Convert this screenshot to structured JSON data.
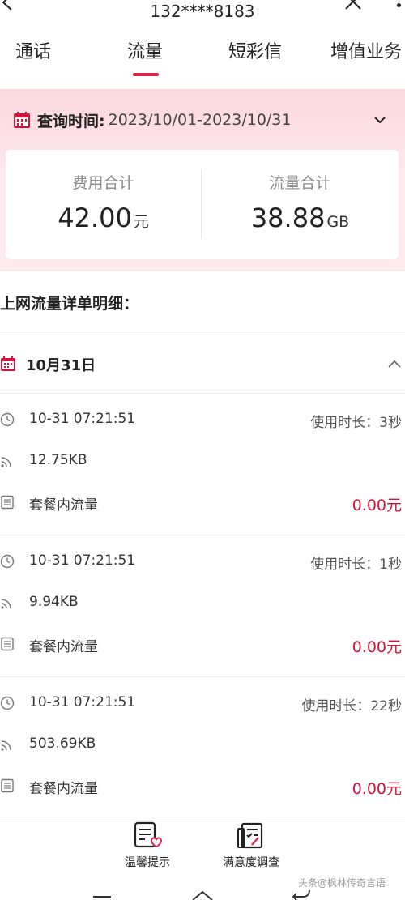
{
  "header": {
    "title": "132****8183"
  },
  "tabs": [
    {
      "label": "通话"
    },
    {
      "label": "流量"
    },
    {
      "label": "短彩信"
    },
    {
      "label": "增值业务"
    }
  ],
  "query": {
    "label": "查询时间:",
    "value": "2023/10/01-2023/10/31"
  },
  "summary": {
    "fee": {
      "label": "费用合计",
      "value": "42.00",
      "unit": "元"
    },
    "traffic": {
      "label": "流量合计",
      "value": "38.88",
      "unit": "GB"
    }
  },
  "section_title": "上网流量详单明细：",
  "day": {
    "label": "10月31日"
  },
  "records": [
    {
      "time": "10-31 07:21:51",
      "duration": "使用时长：3秒",
      "size": "12.75KB",
      "type": "套餐内流量",
      "amount": "0.00元"
    },
    {
      "time": "10-31 07:21:51",
      "duration": "使用时长：1秒",
      "size": "9.94KB",
      "type": "套餐内流量",
      "amount": "0.00元"
    },
    {
      "time": "10-31 07:21:51",
      "duration": "使用时长：22秒",
      "size": "503.69KB",
      "type": "套餐内流量",
      "amount": "0.00元"
    }
  ],
  "actions": [
    {
      "label": "温馨提示"
    },
    {
      "label": "满意度调查"
    }
  ],
  "watermark": "头条@枫林传奇言语",
  "colors": {
    "accent": "#e0254a",
    "amount_red": "#d0143c",
    "header_bg": "#fbd7dd"
  }
}
